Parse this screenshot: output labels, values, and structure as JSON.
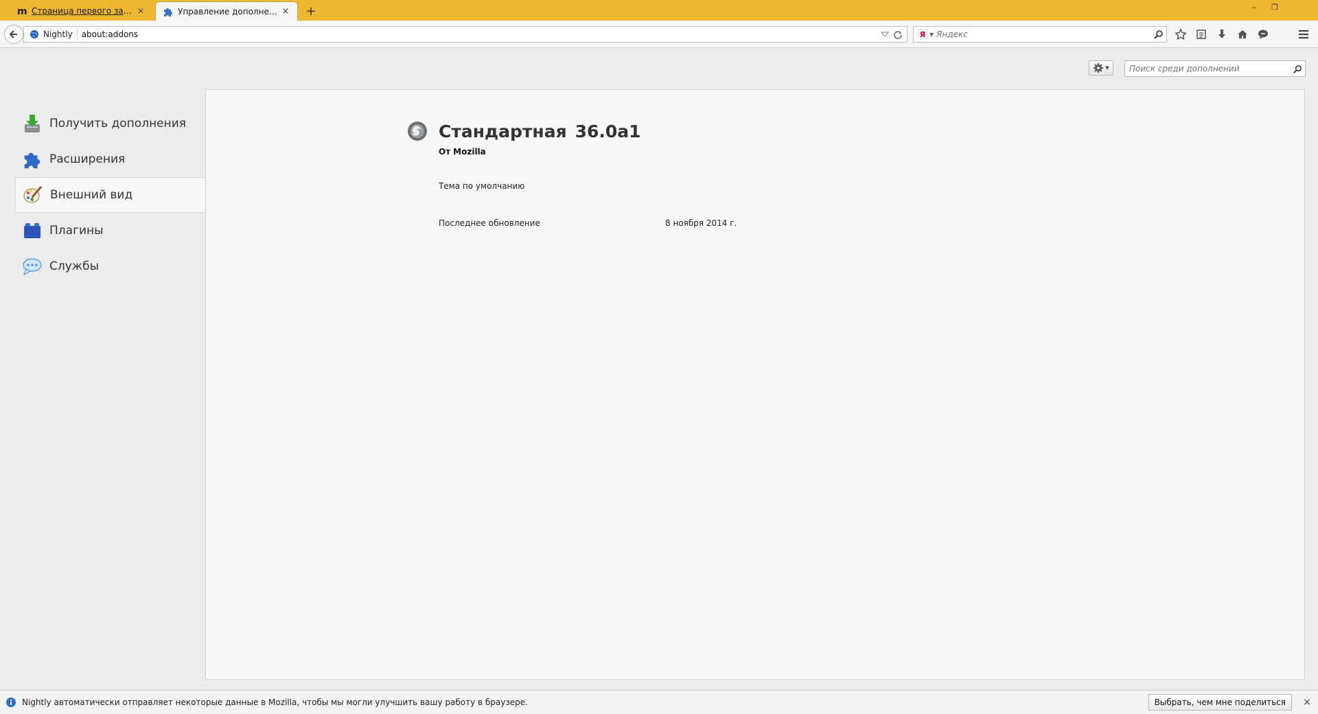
{
  "browser": {
    "tabs": [
      {
        "label": "Страница первого запуск...",
        "favicon": "mozilla-m-icon",
        "active": false
      },
      {
        "label": "Управление дополнениями",
        "favicon": "puzzle-piece-icon",
        "active": true
      }
    ],
    "new_tab_glyph": "+",
    "close_glyph": "×",
    "window_buttons": {
      "minimize": "–",
      "restore": "❐",
      "close": ""
    },
    "urlbar": {
      "identity_label": "Nightly",
      "url": "about:addons"
    },
    "searchbar": {
      "placeholder": "Яндекс",
      "engine_logo": "Я"
    },
    "accent_color": "#efb730"
  },
  "addons": {
    "search_placeholder": "Поиск среди дополнений",
    "categories": [
      {
        "label": "Получить дополнения",
        "icon": "download-addons-icon",
        "selected": false
      },
      {
        "label": "Расширения",
        "icon": "puzzle-piece-icon",
        "selected": false
      },
      {
        "label": "Внешний вид",
        "icon": "paintbrush-palette-icon",
        "selected": true
      },
      {
        "label": "Плагины",
        "icon": "lego-brick-icon",
        "selected": false
      },
      {
        "label": "Службы",
        "icon": "speech-bubble-icon",
        "selected": false
      }
    ],
    "detail": {
      "name": "Стандартная",
      "version": "36.0a1",
      "creator_prefix": "От",
      "creator": "Mozilla",
      "description": "Тема по умолчанию",
      "last_updated_label": "Последнее обновление",
      "last_updated_value": "8 ноября 2014 г."
    }
  },
  "notification": {
    "text": "Nightly автоматически отправляет некоторые данные в Mozilla, чтобы мы могли улучшить вашу работу в браузере.",
    "button": "Выбрать, чем мне поделиться",
    "close_glyph": "×"
  }
}
